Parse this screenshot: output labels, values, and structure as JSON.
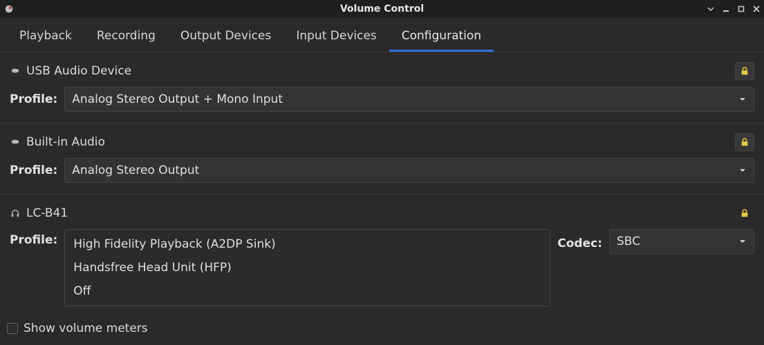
{
  "window": {
    "title": "Volume Control"
  },
  "tabs": [
    {
      "label": "Playback"
    },
    {
      "label": "Recording"
    },
    {
      "label": "Output Devices"
    },
    {
      "label": "Input Devices"
    },
    {
      "label": "Configuration"
    }
  ],
  "devices": [
    {
      "icon": "card",
      "name": "USB Audio Device",
      "profile_label": "Profile:",
      "profile_value": "Analog Stereo Output + Mono Input"
    },
    {
      "icon": "card",
      "name": "Built-in Audio",
      "profile_label": "Profile:",
      "profile_value": "Analog Stereo Output"
    },
    {
      "icon": "headphones",
      "name": "LC-B41",
      "profile_label": "Profile:",
      "profile_options": [
        "High Fidelity Playback (A2DP Sink)",
        "Handsfree Head Unit (HFP)",
        "Off"
      ],
      "codec_label": "Codec:",
      "codec_value": "SBC"
    }
  ],
  "footer": {
    "show_meters_label": "Show volume meters"
  },
  "colors": {
    "accent": "#2f6fe0",
    "lock": "#e7c84a"
  }
}
